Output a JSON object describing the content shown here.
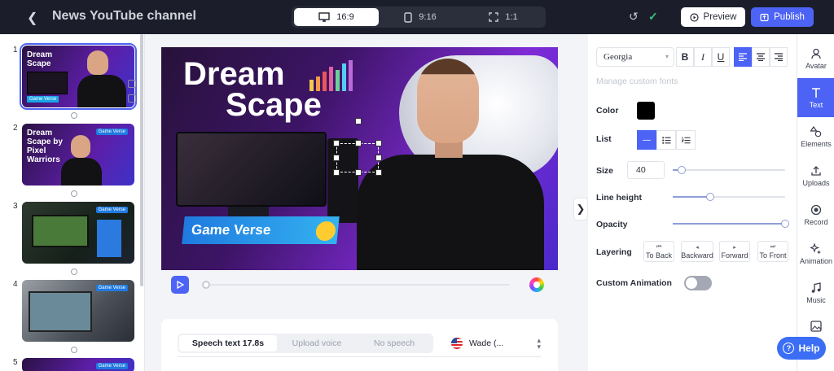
{
  "header": {
    "back_icon": "chevron-left-icon",
    "title": "News YouTube channel",
    "ratios": [
      {
        "label": "16:9",
        "icon": "monitor-icon",
        "active": true
      },
      {
        "label": "9:16",
        "icon": "phone-icon",
        "active": false
      },
      {
        "label": "1:1",
        "icon": "expand-icon",
        "active": false
      }
    ],
    "preview_label": "Preview",
    "publish_label": "Publish"
  },
  "slides": [
    {
      "number": "1",
      "title": "Dream Scape",
      "tag": "Game Verse",
      "selected": true
    },
    {
      "number": "2",
      "title": "Dream Scape by Pixel Warriors",
      "badge": "Game Verse",
      "selected": false
    },
    {
      "number": "3",
      "badge": "Game Verse",
      "selected": false
    },
    {
      "number": "4",
      "badge": "Game Verse",
      "selected": false
    },
    {
      "number": "5",
      "badge": "Game Verse",
      "selected": false
    }
  ],
  "canvas": {
    "title_line1": "Dream",
    "title_line2": "Scape",
    "tag": "Game Verse"
  },
  "speech": {
    "tabs": [
      "Speech text 17.8s",
      "Upload voice",
      "No speech"
    ],
    "active_tab": 0,
    "voice": "Wade (..."
  },
  "properties": {
    "font": "Georgia",
    "manage_fonts": "Manage custom fonts",
    "color_label": "Color",
    "color_value": "#000000",
    "list_label": "List",
    "size_label": "Size",
    "size_value": "40",
    "size_fraction": 0.08,
    "line_height_label": "Line height",
    "line_height_fraction": 0.33,
    "opacity_label": "Opacity",
    "opacity_fraction": 1.0,
    "layering_label": "Layering",
    "layering": [
      "To Back",
      "Backward",
      "Forward",
      "To Front"
    ],
    "custom_animation_label": "Custom Animation",
    "custom_animation_on": false
  },
  "tools": [
    {
      "label": "Avatar",
      "icon": "avatar-icon",
      "active": false
    },
    {
      "label": "Text",
      "icon": "text-icon",
      "active": true
    },
    {
      "label": "Elements",
      "icon": "shapes-icon",
      "active": false
    },
    {
      "label": "Uploads",
      "icon": "upload-icon",
      "active": false
    },
    {
      "label": "Record",
      "icon": "record-icon",
      "active": false
    },
    {
      "label": "Animation",
      "icon": "sparkle-icon",
      "active": false
    },
    {
      "label": "Music",
      "icon": "music-icon",
      "active": false
    }
  ],
  "help_label": "Help",
  "colors": {
    "accent": "#4c63f5",
    "topbar": "#1b1e2a",
    "success": "#34c27a"
  }
}
